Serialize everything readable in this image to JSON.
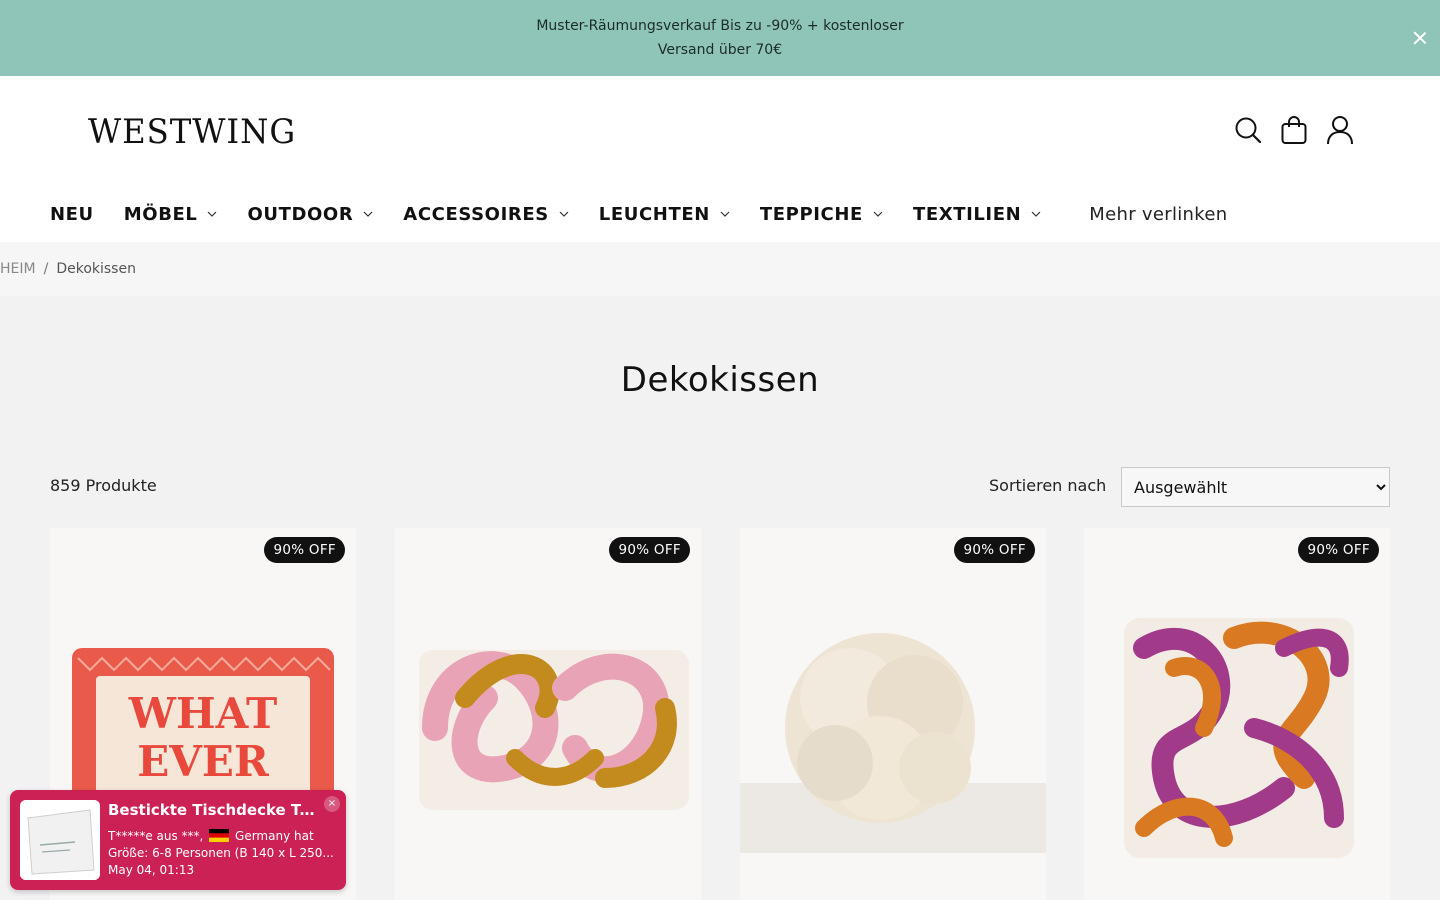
{
  "announcement": {
    "line1": "Muster-Räumungsverkauf Bis zu -90% + kostenloser",
    "line2": "Versand über 70€"
  },
  "header": {
    "logo": "WESTWING",
    "icons": [
      "search-icon",
      "cart-icon",
      "account-icon"
    ]
  },
  "nav": {
    "items": [
      {
        "label": "NEU",
        "dropdown": false
      },
      {
        "label": "MÖBEL",
        "dropdown": true
      },
      {
        "label": "OUTDOOR",
        "dropdown": true
      },
      {
        "label": "ACCESSOIRES",
        "dropdown": true
      },
      {
        "label": "LEUCHTEN",
        "dropdown": true
      },
      {
        "label": "TEPPICHE",
        "dropdown": true
      },
      {
        "label": "TEXTILIEN",
        "dropdown": true
      }
    ],
    "more": "Mehr verlinken"
  },
  "breadcrumb": {
    "home": "HEIM",
    "separator": "/",
    "current": "Dekokissen"
  },
  "page": {
    "title": "Dekokissen",
    "count": "859 Produkte",
    "sort_label": "Sortieren nach",
    "sort_value": "Ausgewählt"
  },
  "products": [
    {
      "badge": "90% OFF",
      "image_text": [
        "WHAT",
        "EVER"
      ]
    },
    {
      "badge": "90% OFF"
    },
    {
      "badge": "90% OFF"
    },
    {
      "badge": "90% OFF"
    }
  ],
  "popup": {
    "title": "Bestickte Tischdecke Tu...",
    "buyer": "T*****e aus ***,",
    "country": "Germany hat",
    "size": "Größe: 6-8 Personen (B 140 x L 250...",
    "time": "May 04, 01:13",
    "close": "×"
  },
  "colors": {
    "announcement_bg": "#8fc5b8",
    "popup_bg": "#cc2154",
    "badge_bg": "#111111",
    "page_bg": "#f3f2f2"
  }
}
